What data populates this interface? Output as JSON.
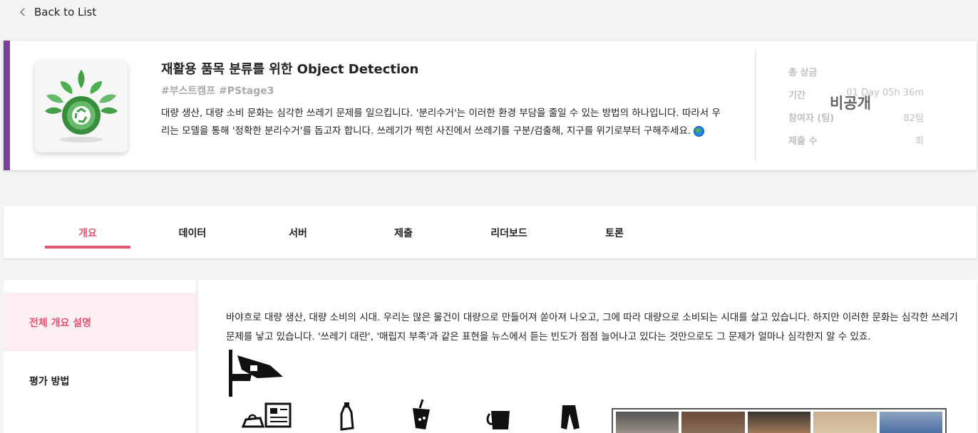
{
  "nav": {
    "back_label": "Back to List"
  },
  "competition": {
    "title": "재활용 품목 분류를 위한 Object Detection",
    "tags": "#부스트캠프 #PStage3",
    "description": "대량 생산, 대량 소비 문화는 심각한 쓰레기 문제를 일으킵니다. '분리수거'는 이러한 환경 부담을 줄일 수 있는 방법의 하나입니다. 따라서 우리는 모델을 통해 '정확한 분리수거'를 돕고자 합니다. 쓰레기가 찍힌 사진에서 쓰레기를 구분/검출해, 지구를 위기로부터 구해주세요.",
    "accent_color": "#7b3f9e"
  },
  "stats": {
    "prize_label": "총 상금",
    "period_label": "기간",
    "period_value": "01 Day 05h 36m",
    "participants_label": "참여자 (팀)",
    "participants_value": "82팀",
    "submissions_label": "제출 수",
    "submissions_value": "회",
    "private_label": "비공개"
  },
  "tabs": [
    {
      "label": "개요",
      "active": true
    },
    {
      "label": "데이터"
    },
    {
      "label": "서버"
    },
    {
      "label": "제출"
    },
    {
      "label": "리더보드"
    },
    {
      "label": "토론"
    }
  ],
  "sidebar": {
    "items": [
      {
        "label": "전체 개요 설명",
        "active": true
      },
      {
        "label": "평가 방법"
      }
    ]
  },
  "overview": {
    "text": "바야흐로 대량 생산, 대량 소비의 시대. 우리는 많은 물건이 대량으로 만들어져 쏟아져 나오고, 그에 따라 대량으로 소비되는 시대를 살고 있습니다. 하지만 이러한 문화는 심각한 쓰레기 문제를 낳고 있습니다. '쓰레기 대란', '매립지 부족'과 같은 표현을 뉴스에서 듣는 빈도가 점점 늘어나고 있다는 것만으로도 그 문제가 얼마나 심각한지 알 수 있죠."
  },
  "theme": {
    "accent": "#e05573",
    "active_bg": "#fdeef1"
  }
}
